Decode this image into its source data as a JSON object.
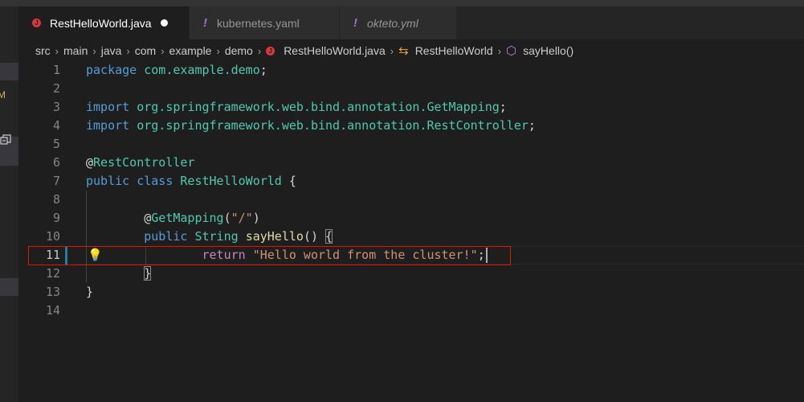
{
  "tabs": [
    {
      "label": "RestHelloWorld.java",
      "icon": "java-icon",
      "active": true,
      "dirty": true,
      "italic": false
    },
    {
      "label": "kubernetes.yaml",
      "icon": "yaml-icon",
      "active": false,
      "dirty": false,
      "italic": false
    },
    {
      "label": "okteto.yml",
      "icon": "yaml-icon",
      "active": false,
      "dirty": false,
      "italic": true
    }
  ],
  "icons": {
    "yaml_glyph": "!",
    "java_glyph": "J",
    "class_glyph": "⇆",
    "method_glyph": "⬡",
    "bulb_glyph": "💡",
    "breadcrumb_separator": "›"
  },
  "breadcrumb": {
    "path": [
      "src",
      "main",
      "java",
      "com",
      "example",
      "demo"
    ],
    "file": "RestHelloWorld.java",
    "class": "RestHelloWorld",
    "method": "sayHello()"
  },
  "sidebar": {
    "badge": "M"
  },
  "editor": {
    "current_line": 11,
    "lines": [
      {
        "num": "1",
        "tokens": [
          {
            "t": "package ",
            "c": "kw"
          },
          {
            "t": "com.example.demo",
            "c": "pkg"
          },
          {
            "t": ";",
            "c": ""
          }
        ]
      },
      {
        "num": "2",
        "tokens": []
      },
      {
        "num": "3",
        "tokens": [
          {
            "t": "import ",
            "c": "kw"
          },
          {
            "t": "org.springframework.web.bind.annotation.GetMapping",
            "c": "pkg"
          },
          {
            "t": ";",
            "c": ""
          }
        ]
      },
      {
        "num": "4",
        "tokens": [
          {
            "t": "import ",
            "c": "kw"
          },
          {
            "t": "org.springframework.web.bind.annotation.RestController",
            "c": "pkg"
          },
          {
            "t": ";",
            "c": ""
          }
        ]
      },
      {
        "num": "5",
        "tokens": []
      },
      {
        "num": "6",
        "tokens": [
          {
            "t": "@",
            "c": "ann-at"
          },
          {
            "t": "RestController",
            "c": "ann"
          }
        ]
      },
      {
        "num": "7",
        "tokens": [
          {
            "t": "public ",
            "c": "kw"
          },
          {
            "t": "class ",
            "c": "kw"
          },
          {
            "t": "RestHelloWorld",
            "c": "ty"
          },
          {
            "t": " {",
            "c": ""
          }
        ]
      },
      {
        "num": "8",
        "tokens": []
      },
      {
        "num": "9",
        "tokens": [
          {
            "t": "        ",
            "c": ""
          },
          {
            "t": "@",
            "c": "ann-at"
          },
          {
            "t": "GetMapping",
            "c": "ann"
          },
          {
            "t": "(",
            "c": ""
          },
          {
            "t": "\"/\"",
            "c": "str"
          },
          {
            "t": ")",
            "c": ""
          }
        ]
      },
      {
        "num": "10",
        "tokens": [
          {
            "t": "        ",
            "c": ""
          },
          {
            "t": "public ",
            "c": "kw"
          },
          {
            "t": "String ",
            "c": "ty"
          },
          {
            "t": "sayHello",
            "c": "fn"
          },
          {
            "t": "() ",
            "c": ""
          },
          {
            "t": "{",
            "c": "brace"
          }
        ]
      },
      {
        "num": "11",
        "tokens": [
          {
            "t": "                ",
            "c": ""
          },
          {
            "t": "return ",
            "c": "kwc"
          },
          {
            "t": "\"Hello world from the cluster!\"",
            "c": "str"
          },
          {
            "t": ";",
            "c": ""
          }
        ]
      },
      {
        "num": "12",
        "tokens": [
          {
            "t": "        ",
            "c": ""
          },
          {
            "t": "}",
            "c": "brace"
          }
        ]
      },
      {
        "num": "13",
        "tokens": [
          {
            "t": "}",
            "c": ""
          }
        ]
      },
      {
        "num": "14",
        "tokens": []
      }
    ]
  }
}
